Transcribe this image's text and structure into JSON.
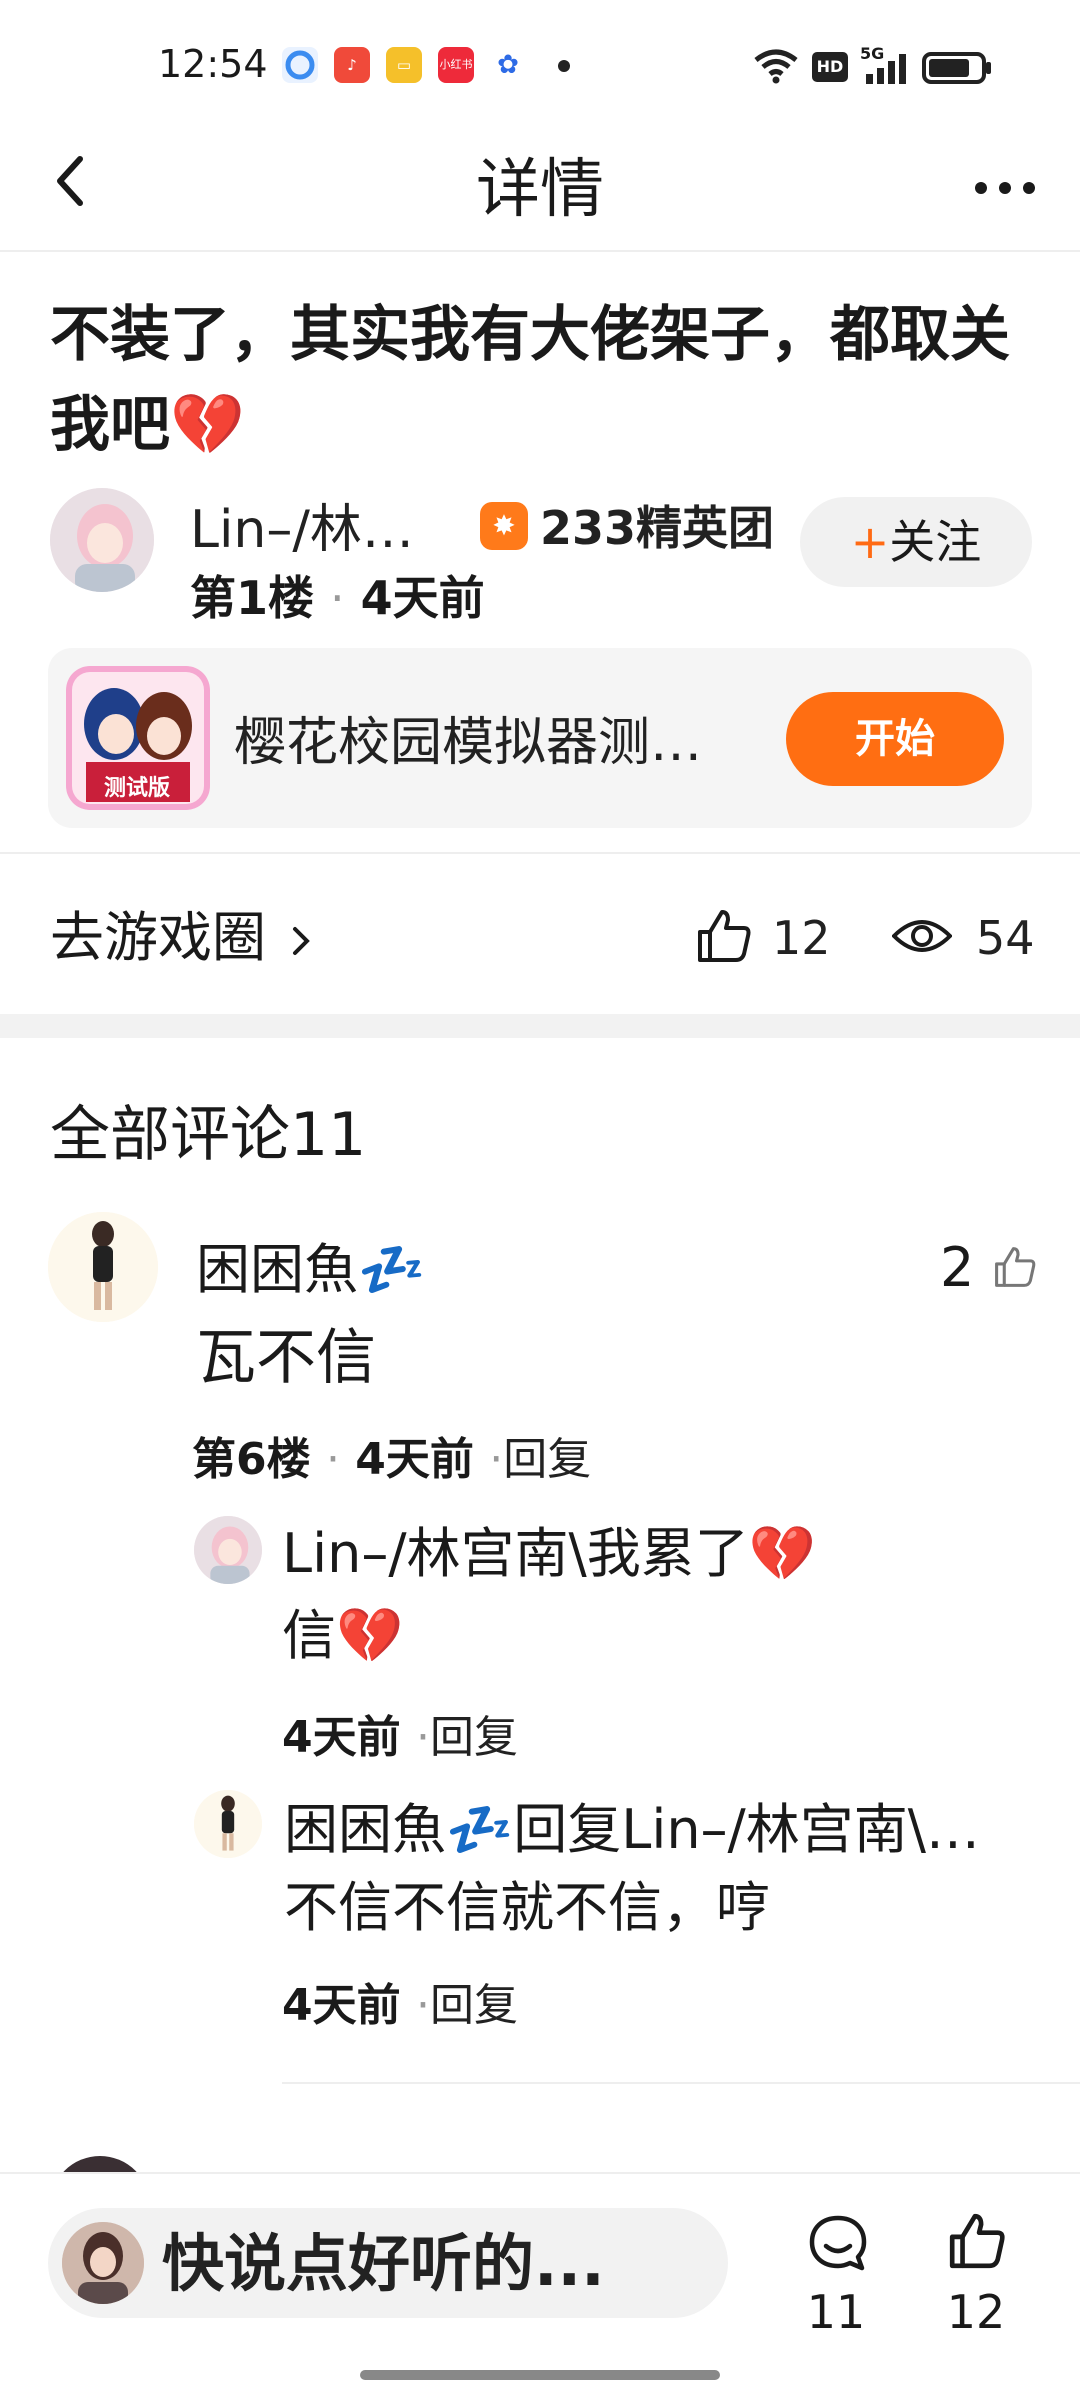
{
  "status_bar": {
    "time": "12:54",
    "apps": [
      {
        "icon": "browser-icon",
        "color": "#3b8cf0"
      },
      {
        "icon": "music-icon",
        "color": "#f04a3a"
      },
      {
        "icon": "notes-icon",
        "color": "#f5c02a"
      },
      {
        "icon": "xiaohongshu-icon",
        "color": "#ee2a3a",
        "label": "小红书"
      },
      {
        "icon": "baidu-icon",
        "color": "#2e6be6"
      }
    ],
    "network": "5G",
    "hd": "HD"
  },
  "header": {
    "title": "详情",
    "back_icon": "chevron-left-icon",
    "more_icon": "more-icon"
  },
  "post": {
    "title": "不装了，其实我有大佬架子，都取关我吧💔",
    "author": "Lin–/林…",
    "badge": "233精英团",
    "follow_label": "关注",
    "follow_plus": "+",
    "floor": "第1楼",
    "time": "4天前",
    "sep": "·"
  },
  "game_card": {
    "name": "樱花校园模拟器测…",
    "icon_label": "测试版",
    "start_label": "开始"
  },
  "stats": {
    "go_circle": "去游戏圈",
    "likes": "12",
    "views": "54"
  },
  "comments": {
    "title": "全部评论11",
    "items": [
      {
        "name": "困困魚💤",
        "text": "瓦不信",
        "likes": "2",
        "floor": "第6楼",
        "time": "4天前",
        "reply_label": "回复",
        "sep": "·",
        "replies": [
          {
            "line1": "Lin–/林宫南\\我累了💔",
            "line2": "信💔",
            "time": "4天前",
            "reply_label": "回复"
          },
          {
            "line1": "困困魚💤回复Lin–/林宫南\\…",
            "line2": "不信不信就不信，哼",
            "time": "4天前",
            "reply_label": "回复"
          }
        ]
      }
    ]
  },
  "bottom_bar": {
    "placeholder": "快说点好听的...",
    "comments_count": "11",
    "likes_count": "12"
  },
  "colors": {
    "accent": "#ff6e12",
    "pill_bg": "#f2f2f2"
  }
}
